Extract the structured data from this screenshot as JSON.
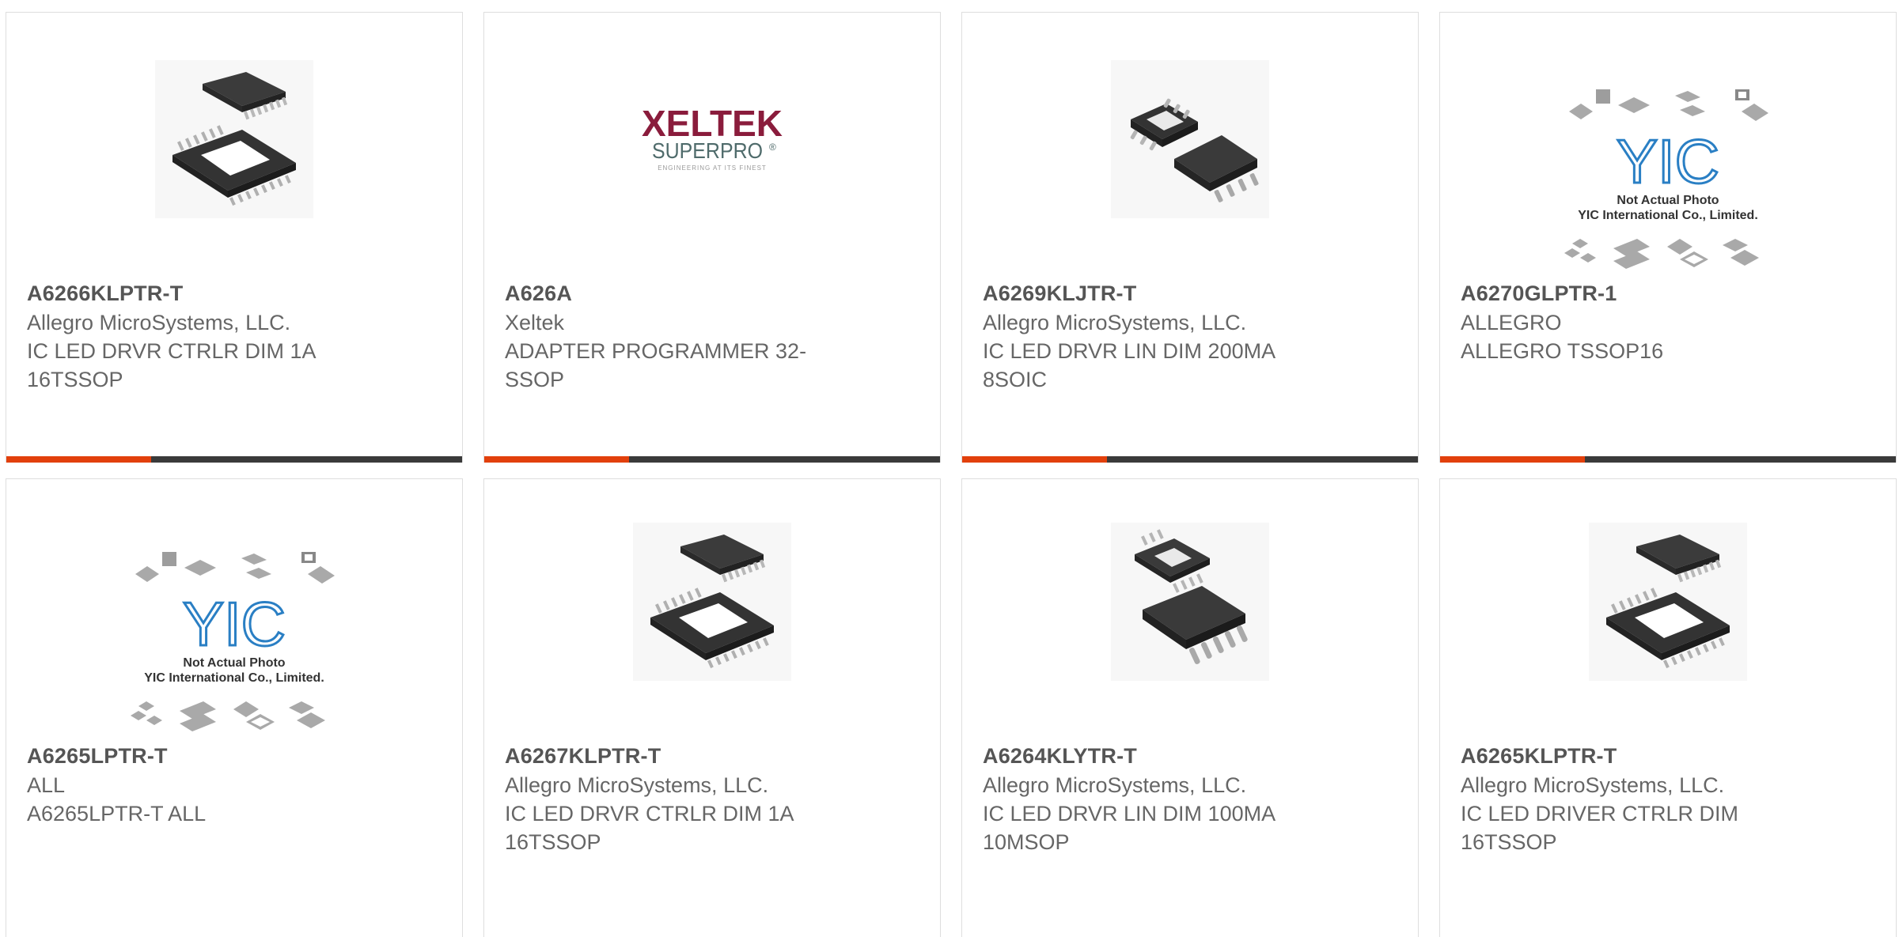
{
  "colors": {
    "accent": "#e2400c",
    "bar": "#3a3a3a",
    "border": "#dedede",
    "text": "#555555"
  },
  "products": [
    {
      "part": "A6266KLPTR-T",
      "manufacturer": "Allegro MicroSystems, LLC.",
      "description": "IC LED DRVR CTRLR DIM 1A 16TSSOP",
      "image": "tssop-chip-image"
    },
    {
      "part": "A626A",
      "manufacturer": "Xeltek",
      "description": "ADAPTER PROGRAMMER 32-SSOP",
      "image": "xeltek-logo",
      "logo": {
        "brand": "XELTEK",
        "sub": "SUPERPRO",
        "reg": "®",
        "tagline": "ENGINEERING AT ITS FINEST"
      }
    },
    {
      "part": "A6269KLJTR-T",
      "manufacturer": "Allegro MicroSystems, LLC.",
      "description": "IC LED DRVR LIN DIM 200MA 8SOIC",
      "image": "soic-chip-image"
    },
    {
      "part": "A6270GLPTR-1",
      "manufacturer": "ALLEGRO",
      "description": "ALLEGRO TSSOP16",
      "image": "placeholder-image",
      "placeholder": {
        "logo": "YIC",
        "line1": "Not Actual Photo",
        "line2": "YIC International Co., Limited."
      }
    },
    {
      "part": "A6265LPTR-T",
      "manufacturer": "ALL",
      "description": "A6265LPTR-T ALL",
      "image": "placeholder-image",
      "placeholder": {
        "logo": "YIC",
        "line1": "Not Actual Photo",
        "line2": "YIC International Co., Limited."
      }
    },
    {
      "part": "A6267KLPTR-T",
      "manufacturer": "Allegro MicroSystems, LLC.",
      "description": "IC LED DRVR CTRLR DIM 1A 16TSSOP",
      "image": "tssop-chip-image"
    },
    {
      "part": "A6264KLYTR-T",
      "manufacturer": "Allegro MicroSystems, LLC.",
      "description": "IC LED DRVR LIN DIM 100MA 10MSOP",
      "image": "msop-chip-image"
    },
    {
      "part": "A6265KLPTR-T",
      "manufacturer": "Allegro MicroSystems, LLC.",
      "description": "IC LED DRIVER CTRLR DIM 16TSSOP",
      "image": "tssop-chip-image"
    }
  ]
}
